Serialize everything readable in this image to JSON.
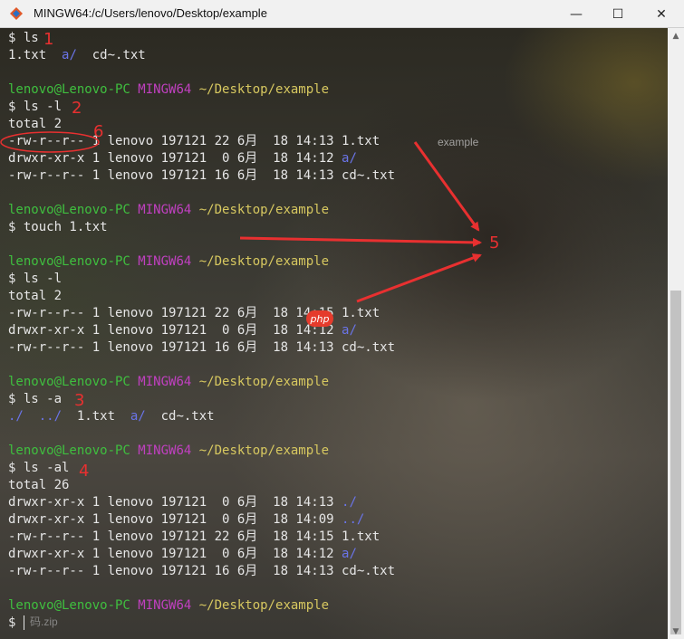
{
  "window": {
    "title": "MINGW64:/c/Users/lenovo/Desktop/example",
    "icon": "git-bash-icon",
    "controls": {
      "minimize": "—",
      "maximize": "☐",
      "close": "✕"
    }
  },
  "desktop": {
    "folder_label": "example",
    "bottom_item": "码.zip"
  },
  "terminal": {
    "lines": [
      {
        "seg": [
          {
            "t": "$ ls"
          }
        ]
      },
      {
        "seg": [
          {
            "t": "1.txt  "
          },
          {
            "t": "a/",
            "c": "b"
          },
          {
            "t": "  cd~.txt"
          }
        ]
      },
      {
        "seg": [
          {
            "t": ""
          }
        ]
      },
      {
        "seg": [
          {
            "t": "lenovo@Lenovo-PC ",
            "c": "g"
          },
          {
            "t": "MINGW64 ",
            "c": "m"
          },
          {
            "t": "~/Desktop/example",
            "c": "y"
          }
        ]
      },
      {
        "seg": [
          {
            "t": "$ ls -l"
          }
        ]
      },
      {
        "seg": [
          {
            "t": "total 2"
          }
        ]
      },
      {
        "seg": [
          {
            "t": "-rw-r--r-- 1 lenovo 197121 22 6月  18 14:13 1.txt"
          }
        ]
      },
      {
        "seg": [
          {
            "t": "drwxr-xr-x 1 lenovo 197121  0 6月  18 14:12 "
          },
          {
            "t": "a/",
            "c": "b"
          }
        ]
      },
      {
        "seg": [
          {
            "t": "-rw-r--r-- 1 lenovo 197121 16 6月  18 14:13 cd~.txt"
          }
        ]
      },
      {
        "seg": [
          {
            "t": ""
          }
        ]
      },
      {
        "seg": [
          {
            "t": "lenovo@Lenovo-PC ",
            "c": "g"
          },
          {
            "t": "MINGW64 ",
            "c": "m"
          },
          {
            "t": "~/Desktop/example",
            "c": "y"
          }
        ]
      },
      {
        "seg": [
          {
            "t": "$ touch 1.txt"
          }
        ]
      },
      {
        "seg": [
          {
            "t": ""
          }
        ]
      },
      {
        "seg": [
          {
            "t": "lenovo@Lenovo-PC ",
            "c": "g"
          },
          {
            "t": "MINGW64 ",
            "c": "m"
          },
          {
            "t": "~/Desktop/example",
            "c": "y"
          }
        ]
      },
      {
        "seg": [
          {
            "t": "$ ls -l"
          }
        ]
      },
      {
        "seg": [
          {
            "t": "total 2"
          }
        ]
      },
      {
        "seg": [
          {
            "t": "-rw-r--r-- 1 lenovo 197121 22 6月  18 14:15 1.txt"
          }
        ]
      },
      {
        "seg": [
          {
            "t": "drwxr-xr-x 1 lenovo 197121  0 6月  18 14:12 "
          },
          {
            "t": "a/",
            "c": "b"
          }
        ]
      },
      {
        "seg": [
          {
            "t": "-rw-r--r-- 1 lenovo 197121 16 6月  18 14:13 cd~.txt"
          }
        ]
      },
      {
        "seg": [
          {
            "t": ""
          }
        ]
      },
      {
        "seg": [
          {
            "t": "lenovo@Lenovo-PC ",
            "c": "g"
          },
          {
            "t": "MINGW64 ",
            "c": "m"
          },
          {
            "t": "~/Desktop/example",
            "c": "y"
          }
        ]
      },
      {
        "seg": [
          {
            "t": "$ ls -a"
          }
        ]
      },
      {
        "seg": [
          {
            "t": "./",
            "c": "b"
          },
          {
            "t": "  "
          },
          {
            "t": "../",
            "c": "b"
          },
          {
            "t": "  1.txt  "
          },
          {
            "t": "a/",
            "c": "b"
          },
          {
            "t": "  cd~.txt"
          }
        ]
      },
      {
        "seg": [
          {
            "t": ""
          }
        ]
      },
      {
        "seg": [
          {
            "t": "lenovo@Lenovo-PC ",
            "c": "g"
          },
          {
            "t": "MINGW64 ",
            "c": "m"
          },
          {
            "t": "~/Desktop/example",
            "c": "y"
          }
        ]
      },
      {
        "seg": [
          {
            "t": "$ ls -al"
          }
        ]
      },
      {
        "seg": [
          {
            "t": "total 26"
          }
        ]
      },
      {
        "seg": [
          {
            "t": "drwxr-xr-x 1 lenovo 197121  0 6月  18 14:13 "
          },
          {
            "t": "./",
            "c": "b"
          }
        ]
      },
      {
        "seg": [
          {
            "t": "drwxr-xr-x 1 lenovo 197121  0 6月  18 14:09 "
          },
          {
            "t": "../",
            "c": "b"
          }
        ]
      },
      {
        "seg": [
          {
            "t": "-rw-r--r-- 1 lenovo 197121 22 6月  18 14:15 1.txt"
          }
        ]
      },
      {
        "seg": [
          {
            "t": "drwxr-xr-x 1 lenovo 197121  0 6月  18 14:12 "
          },
          {
            "t": "a/",
            "c": "b"
          }
        ]
      },
      {
        "seg": [
          {
            "t": "-rw-r--r-- 1 lenovo 197121 16 6月  18 14:13 cd~.txt"
          }
        ]
      },
      {
        "seg": [
          {
            "t": ""
          }
        ]
      },
      {
        "seg": [
          {
            "t": "lenovo@Lenovo-PC ",
            "c": "g"
          },
          {
            "t": "MINGW64 ",
            "c": "m"
          },
          {
            "t": "~/Desktop/example",
            "c": "y"
          }
        ]
      },
      {
        "seg": [
          {
            "t": "$ "
          }
        ]
      }
    ]
  },
  "annotations": {
    "n1": "1",
    "n2": "2",
    "n3": "3",
    "n4": "4",
    "n5": "5",
    "n6": "6",
    "badge": "php"
  },
  "colors": {
    "annotation": "#e83030",
    "prompt_user": "#3fbf3f",
    "prompt_mingw": "#c040c0",
    "prompt_path": "#d7c860",
    "dir": "#6a74e8"
  }
}
